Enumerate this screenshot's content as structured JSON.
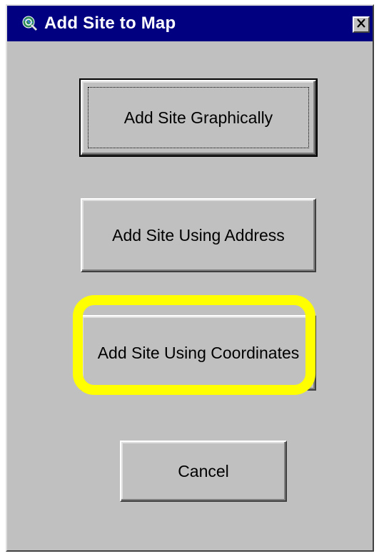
{
  "window": {
    "title": "Add Site to Map",
    "icon": "globe-magnifier-icon",
    "close_icon": "close-icon"
  },
  "buttons": {
    "graphically": "Add Site Graphically",
    "address": "Add Site Using Address",
    "coordinates": "Add Site Using Coordinates",
    "cancel": "Cancel"
  },
  "highlight": {
    "target": "coordinates",
    "color": "#ffff00"
  },
  "colors": {
    "titlebar": "#000080",
    "dialog_bg": "#c0c0c0"
  }
}
